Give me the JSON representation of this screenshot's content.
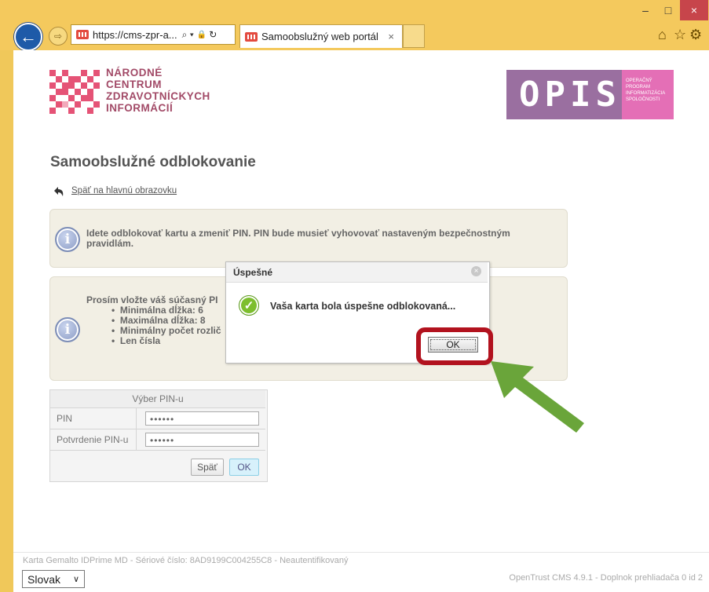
{
  "browser": {
    "address_text": "https://cms-zpr-a...",
    "tab_title": "Samoobslužný web portál",
    "tab_close": "×",
    "back_glyph": "←",
    "forward_glyph": "⇨",
    "search_glyph": "⌕ ▾",
    "lock_glyph": "🔒",
    "refresh_glyph": "↻",
    "home_icon": "⌂",
    "star_icon": "☆",
    "gear_icon": "⚙",
    "minimize": "–",
    "maximize": "□",
    "close": "×",
    "close_bg": "#c7454b"
  },
  "header": {
    "logo_lines": [
      "NÁRODNÉ",
      "CENTRUM",
      "ZDRAVOTNÍCKYCH",
      "INFORMÁCIÍ"
    ],
    "opis_letters": "OPIS",
    "opis_sub": [
      "OPERAČNÝ",
      "PROGRAM",
      "INFORMATIZÁCIA",
      "SPOLOČNOSTI"
    ],
    "logo_color": "#e55376"
  },
  "main": {
    "title": "Samoobslužné odblokovanie",
    "back_link": "Späť na hlavnú obrazovku",
    "info1": "Idete odblokovať kartu a zmeniť PIN. PIN bude musieť vyhovovať nastaveným bezpečnostným pravidlám.",
    "info2_intro": "Prosím vložte váš súčasný PI",
    "info2_items": [
      "Minimálna dĺžka: 6",
      "Maximálna dĺžka: 8",
      "Minimálny počet rozlič",
      "Len čísla"
    ]
  },
  "pin_form": {
    "header": "Výber PIN-u",
    "pin_label": "PIN",
    "pin_value": "••••••",
    "confirm_label": "Potvrdenie PIN-u",
    "confirm_value": "••••••",
    "back_button": "Späť",
    "ok_button": "OK"
  },
  "dialog": {
    "title": "Úspešné",
    "message": "Vaša karta bola úspešne odblokovaná...",
    "ok_button": "OK",
    "highlight_color": "#b2121e",
    "arrow_color": "#6aa53a"
  },
  "status_bar": {
    "card_info": "Karta Gemalto IDPrime MD - Sériové číslo: 8AD9199C004255C8 - Neautentifikovaný",
    "language": "Slovak",
    "version": "OpenTrust CMS 4.9.1 - Doplnok prehliadača 0 id 2"
  }
}
